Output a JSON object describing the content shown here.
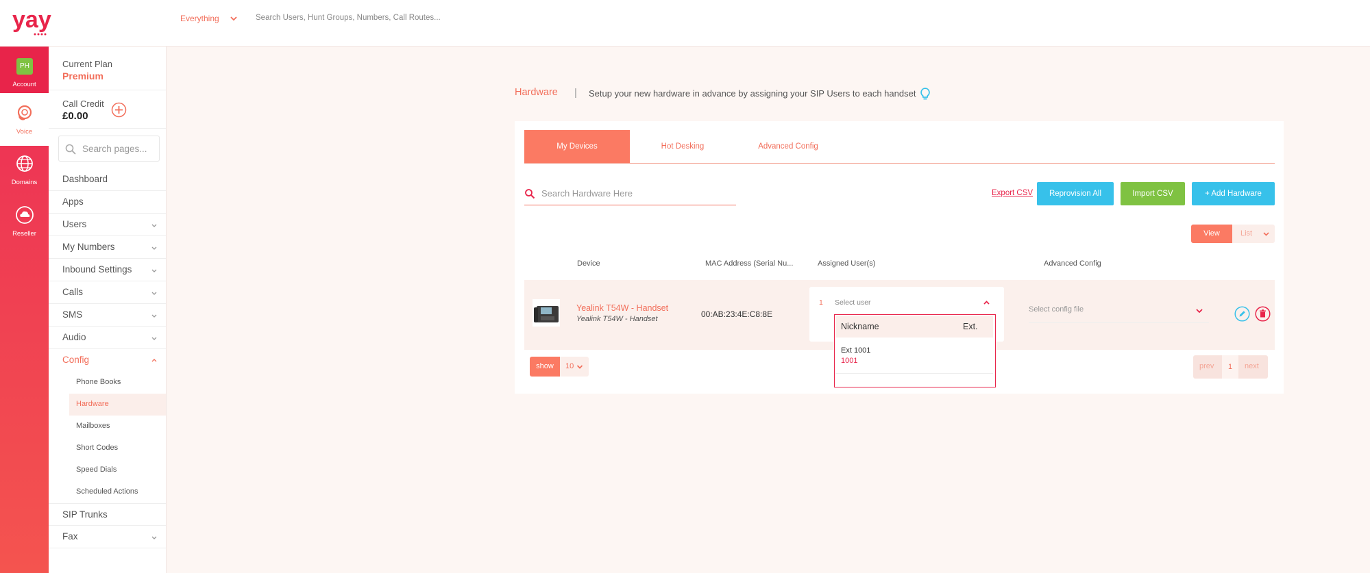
{
  "app": {
    "logo_text": "yay"
  },
  "topbar": {
    "scope": "Everything",
    "search_placeholder": "Search Users, Hunt Groups, Numbers, Call Routes..."
  },
  "rail": [
    {
      "label": "Account",
      "avatar": "PH",
      "icon": "avatar-icon"
    },
    {
      "label": "Voice",
      "icon": "headset-icon"
    },
    {
      "label": "Domains",
      "icon": "globe-icon"
    },
    {
      "label": "Reseller",
      "icon": "cloud-icon"
    }
  ],
  "sidebar": {
    "plan_label": "Current Plan",
    "plan_value": "Premium",
    "credit_label": "Call Credit",
    "credit_value": "£0.00",
    "search_placeholder": "Search pages...",
    "items": [
      {
        "label": "Dashboard"
      },
      {
        "label": "Apps"
      },
      {
        "label": "Users"
      },
      {
        "label": "My Numbers"
      },
      {
        "label": "Inbound Settings"
      },
      {
        "label": "Calls"
      },
      {
        "label": "SMS"
      },
      {
        "label": "Audio"
      },
      {
        "label": "Config"
      },
      {
        "label": "SIP Trunks"
      },
      {
        "label": "Fax"
      }
    ],
    "config_sub": [
      {
        "label": "Phone Books"
      },
      {
        "label": "Hardware"
      },
      {
        "label": "Mailboxes"
      },
      {
        "label": "Short Codes"
      },
      {
        "label": "Speed Dials"
      },
      {
        "label": "Scheduled Actions"
      }
    ]
  },
  "page": {
    "breadcrumb": "Hardware",
    "divider": "|",
    "description": "Setup your new hardware in advance by assigning your SIP Users to each handset"
  },
  "tabs": [
    {
      "label": "My Devices"
    },
    {
      "label": "Hot Desking"
    },
    {
      "label": "Advanced Config"
    }
  ],
  "toolbar": {
    "search_placeholder": "Search Hardware Here",
    "export_label": "Export CSV",
    "reprovision_label": "Reprovision All",
    "import_label": "Import CSV",
    "add_label": "+ Add Hardware"
  },
  "view_toggle": {
    "view": "View",
    "list": "List"
  },
  "table": {
    "headers": [
      "Device",
      "MAC Address (Serial Nu...",
      "Assigned User(s)",
      "Advanced Config"
    ],
    "rows": [
      {
        "device_name": "Yealink T54W - Handset",
        "device_model": "Yealink T54W - Handset",
        "mac": "00:AB:23:4E:C8:8E",
        "assign_index": "1",
        "assign_placeholder": "Select user",
        "config_placeholder": "Select config file"
      }
    ]
  },
  "user_dropdown": {
    "col_nickname": "Nickname",
    "col_ext": "Ext.",
    "options": [
      {
        "name": "Ext 1001",
        "ext": "1001"
      }
    ]
  },
  "pagination": {
    "show_label": "show",
    "per_page": "10",
    "prev": "prev",
    "current": "1",
    "next": "next"
  },
  "colors": {
    "brand": "#f26e5a",
    "accent_red": "#e8244a",
    "blue": "#37c1ea",
    "green": "#7fc242"
  }
}
